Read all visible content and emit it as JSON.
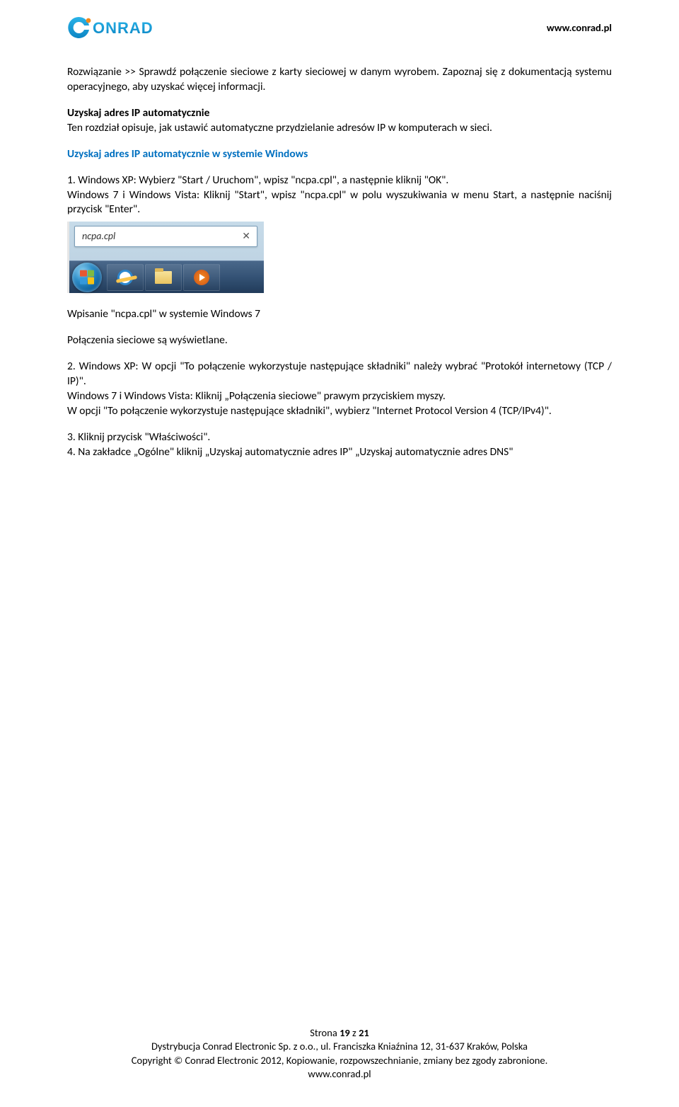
{
  "header": {
    "url": "www.conrad.pl"
  },
  "body": {
    "p1": "Rozwiązanie >> Sprawdź połączenie sieciowe z karty sieciowej w danym wyrobem. Zapoznaj się z dokumentacją systemu operacyjnego, aby uzyskać więcej informacji.",
    "h1": "Uzyskaj adres IP automatycznie",
    "p2": "Ten rozdział opisuje, jak ustawić automatyczne przydzielanie adresów IP w komputerach w sieci.",
    "h2": "Uzyskaj adres IP automatycznie w systemie Windows",
    "p3": "1. Windows XP: Wybierz \"Start / Uruchom\", wpisz \"ncpa.cpl\", a następnie kliknij \"OK\".",
    "p4": "Windows 7 i Windows Vista: Kliknij \"Start\", wpisz \"ncpa.cpl\" w polu wyszukiwania w menu Start, a następnie naciśnij przycisk \"Enter\".",
    "search_value": "ncpa.cpl",
    "caption": "Wpisanie \"ncpa.cpl\" w systemie Windows 7",
    "p5": "Połączenia sieciowe są wyświetlane.",
    "p6": " 2. Windows XP: W opcji \"To połączenie wykorzystuje następujące składniki\" należy wybrać \"Protokół internetowy (TCP / IP)\".",
    "p7": " Windows 7 i Windows Vista: Kliknij „Połączenia sieciowe\" prawym przyciskiem myszy.",
    "p8": "W opcji \"To połączenie wykorzystuje następujące składniki\", wybierz \"Internet Protocol Version 4 (TCP/IPv4)\".",
    "p9": "3. Kliknij przycisk \"Właściwości\".",
    "p10": "4. Na zakładce „Ogólne\"  kliknij „Uzyskaj automatycznie adres IP\" „Uzyskaj automatycznie adres DNS\""
  },
  "footer": {
    "line1_a": "Strona ",
    "line1_b": "19",
    "line1_c": " z ",
    "line1_d": "21",
    "line2": "Dystrybucja Conrad Electronic Sp. z o.o., ul. Franciszka Kniaźnina 12, 31-637 Kraków, Polska",
    "line3": "Copyright © Conrad Electronic 2012, Kopiowanie, rozpowszechnianie, zmiany bez zgody zabronione.",
    "line4": "www.conrad.pl"
  }
}
